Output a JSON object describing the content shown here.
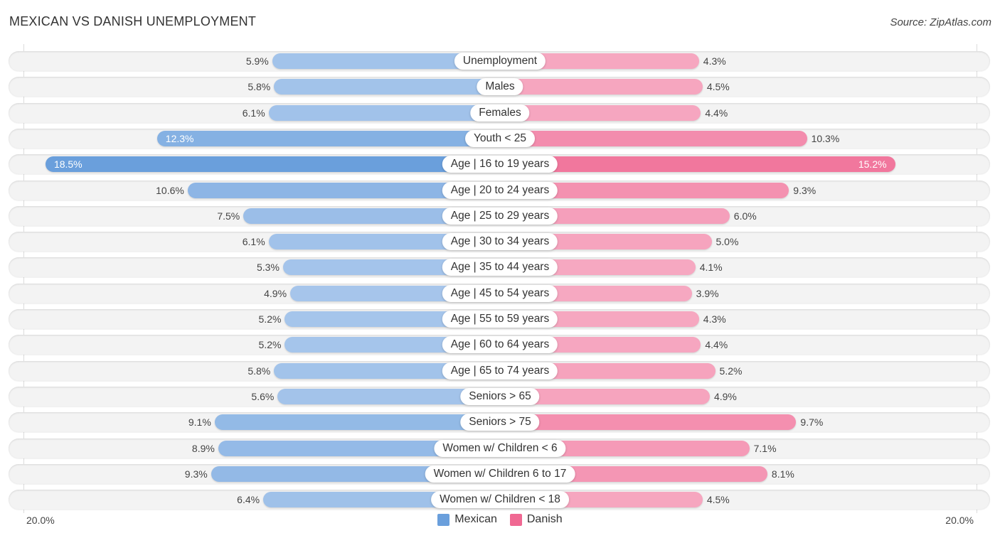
{
  "header": {
    "title": "MEXICAN VS DANISH UNEMPLOYMENT",
    "source": "Source: ZipAtlas.com"
  },
  "colors": {
    "mexican_strong": "#6a9fdc",
    "mexican_light": "#aac8ec",
    "danish_strong": "#f06892",
    "danish_light": "#f6a8c1"
  },
  "chart_data": {
    "type": "bar",
    "orientation": "horizontal-diverging",
    "title": "MEXICAN VS DANISH UNEMPLOYMENT",
    "xlabel": "",
    "ylabel": "",
    "xlim": [
      -20,
      20
    ],
    "axis_labels": {
      "left": "20.0%",
      "right": "20.0%"
    },
    "legend": {
      "position": "bottom-center",
      "entries": [
        "Mexican",
        "Danish"
      ]
    },
    "categories": [
      "Unemployment",
      "Males",
      "Females",
      "Youth < 25",
      "Age | 16 to 19 years",
      "Age | 20 to 24 years",
      "Age | 25 to 29 years",
      "Age | 30 to 34 years",
      "Age | 35 to 44 years",
      "Age | 45 to 54 years",
      "Age | 55 to 59 years",
      "Age | 60 to 64 years",
      "Age | 65 to 74 years",
      "Seniors > 65",
      "Seniors > 75",
      "Women w/ Children < 6",
      "Women w/ Children 6 to 17",
      "Women w/ Children < 18"
    ],
    "series": [
      {
        "name": "Mexican",
        "values": [
          5.9,
          5.8,
          6.1,
          12.3,
          18.5,
          10.6,
          7.5,
          6.1,
          5.3,
          4.9,
          5.2,
          5.2,
          5.8,
          5.6,
          9.1,
          8.9,
          9.3,
          6.4
        ],
        "labels": [
          "5.9%",
          "5.8%",
          "6.1%",
          "12.3%",
          "18.5%",
          "10.6%",
          "7.5%",
          "6.1%",
          "5.3%",
          "4.9%",
          "5.2%",
          "5.2%",
          "5.8%",
          "5.6%",
          "9.1%",
          "8.9%",
          "9.3%",
          "6.4%"
        ]
      },
      {
        "name": "Danish",
        "values": [
          4.3,
          4.5,
          4.4,
          10.3,
          15.2,
          9.3,
          6.0,
          5.0,
          4.1,
          3.9,
          4.3,
          4.4,
          5.2,
          4.9,
          9.7,
          7.1,
          8.1,
          4.5
        ],
        "labels": [
          "4.3%",
          "4.5%",
          "4.4%",
          "10.3%",
          "15.2%",
          "9.3%",
          "6.0%",
          "5.0%",
          "4.1%",
          "3.9%",
          "4.3%",
          "4.4%",
          "5.2%",
          "4.9%",
          "9.7%",
          "7.1%",
          "8.1%",
          "4.5%"
        ]
      }
    ]
  }
}
